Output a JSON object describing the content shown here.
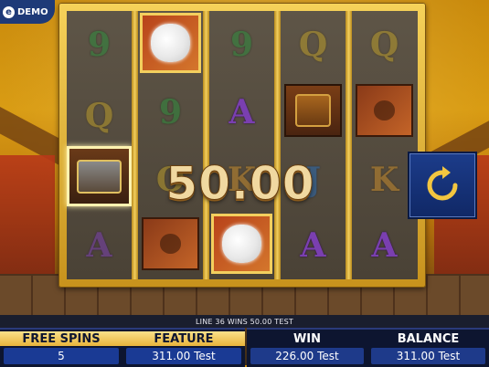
{
  "badge": {
    "icon": "info-icon",
    "label": "DEMO"
  },
  "colors": {
    "frame_gold": "#f3cf5e",
    "panel_navy": "#0d1530",
    "value_blue": "#1e3a8a",
    "win_text": "#f0d8a0",
    "spin_button": "#1c3c8a"
  },
  "reels": [
    {
      "symbols": [
        "9",
        "Q",
        "chest-scatter",
        "A"
      ]
    },
    {
      "symbols": [
        "cloud",
        "9",
        "?",
        "cannon-map"
      ]
    },
    {
      "symbols": [
        "9",
        "A",
        "K",
        "cloud"
      ]
    },
    {
      "symbols": [
        "Q",
        "treasure-chest",
        "J",
        "A"
      ]
    },
    {
      "symbols": [
        "Q",
        "cannon-map",
        "K",
        "A"
      ]
    }
  ],
  "win_overlay": "50.00",
  "spin_button": {
    "icon": "spin-refresh-icon"
  },
  "status_line": "LINE 36 WINS 50.00 TEST",
  "panels": {
    "free_spins": {
      "label": "FREE SPINS",
      "value": "5"
    },
    "feature": {
      "label": "FEATURE",
      "value": "311.00 Test"
    },
    "win": {
      "label": "WIN",
      "value": "226.00 Test"
    },
    "balance": {
      "label": "BALANCE",
      "value": "311.00 Test"
    }
  }
}
